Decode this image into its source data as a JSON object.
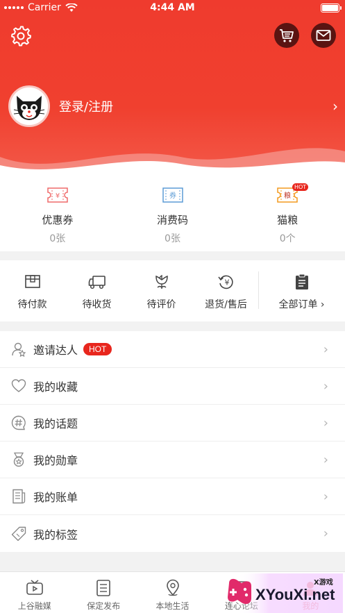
{
  "status_bar": {
    "carrier": "Carrier",
    "time": "4:44 AM"
  },
  "header": {
    "settings_icon": "gear-icon",
    "cart_icon": "cart-icon",
    "mail_icon": "mail-icon",
    "login_text": "登录/注册",
    "chevron": "›"
  },
  "stats": [
    {
      "label": "优惠券",
      "value": "0张",
      "icon": "coupon-icon",
      "glyph": "¥"
    },
    {
      "label": "消费码",
      "value": "0张",
      "icon": "voucher-icon",
      "glyph": "券"
    },
    {
      "label": "猫粮",
      "value": "0个",
      "icon": "cat-food-icon",
      "glyph": "粮",
      "badge": "HOT"
    }
  ],
  "orders": [
    {
      "label": "待付款",
      "icon": "wallet-icon"
    },
    {
      "label": "待收货",
      "icon": "truck-icon"
    },
    {
      "label": "待评价",
      "icon": "flower-icon"
    },
    {
      "label": "退货/售后",
      "icon": "refund-icon"
    },
    {
      "label": "全部订单 ›",
      "icon": "clipboard-icon"
    }
  ],
  "menu": [
    {
      "label": "邀请达人",
      "icon": "invite-user-icon",
      "badge": "HOT"
    },
    {
      "label": "我的收藏",
      "icon": "heart-icon"
    },
    {
      "label": "我的话题",
      "icon": "hashtag-icon"
    },
    {
      "label": "我的勋章",
      "icon": "medal-icon"
    },
    {
      "label": "我的账单",
      "icon": "bill-icon"
    },
    {
      "label": "我的标签",
      "icon": "tag-icon"
    }
  ],
  "tabs": [
    {
      "label": "上谷融媒",
      "icon": "tv-icon"
    },
    {
      "label": "保定发布",
      "icon": "document-icon"
    },
    {
      "label": "本地生活",
      "icon": "location-icon"
    },
    {
      "label": "连心论坛",
      "icon": "forum-icon"
    },
    {
      "label": "我的",
      "icon": "profile-icon",
      "active": true
    }
  ],
  "watermark": {
    "site": "XYouXi.net",
    "small": "X游戏"
  },
  "colors": {
    "accent": "#e8261d",
    "header": "#ef3b2e",
    "text": "#333333",
    "muted": "#999999"
  }
}
